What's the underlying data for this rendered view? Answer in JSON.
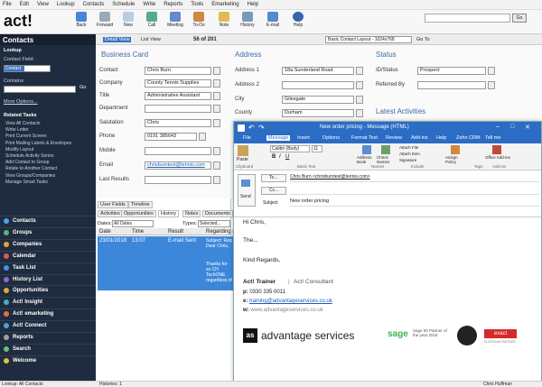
{
  "menu": [
    "File",
    "Edit",
    "View",
    "Lookup",
    "Contacts",
    "Schedule",
    "Write",
    "Reports",
    "Tools",
    "Emarketing",
    "Help"
  ],
  "logo": "act!",
  "toolbar": {
    "back": "Back",
    "forward": "Forward",
    "new": "New",
    "call": "Call",
    "meeting": "Meeting",
    "todo": "To-Do",
    "note": "Note",
    "history": "History",
    "email": "E-mail",
    "help": "Help",
    "search_go": "Go"
  },
  "nav": {
    "title": "Contacts",
    "lookup": "Lookup",
    "contact_field": "Contact Field:",
    "field_value": "Contact",
    "contains": "Contains:",
    "go": "Go",
    "more_options": "More Options...",
    "related_tasks": "Related Tasks",
    "tasks": [
      "View All Contacts",
      "Write Letter",
      "Print Current Screen",
      "Print Mailing Labels & Envelopes",
      "Modify Layout",
      "Schedule Activity Series",
      "Add Contact to Group",
      "Relate to Another Contact",
      "View Groups/Companies",
      "Manage Smart Tasks"
    ],
    "buttons": [
      {
        "label": "Contacts",
        "color": "#4aa3e8"
      },
      {
        "label": "Groups",
        "color": "#5bb56a"
      },
      {
        "label": "Companies",
        "color": "#e0a33a"
      },
      {
        "label": "Calendar",
        "color": "#e05a4a"
      },
      {
        "label": "Task List",
        "color": "#4a8ee0"
      },
      {
        "label": "History List",
        "color": "#8a6ad0"
      },
      {
        "label": "Opportunities",
        "color": "#d0b040"
      },
      {
        "label": "Act! Insight",
        "color": "#40b0c0"
      },
      {
        "label": "Act! emarketing",
        "color": "#e07040"
      },
      {
        "label": "Act! Connect",
        "color": "#50a0e0"
      },
      {
        "label": "Reports",
        "color": "#a0a0a0"
      },
      {
        "label": "Search",
        "color": "#70c070"
      },
      {
        "label": "Welcome",
        "color": "#e0c040"
      }
    ]
  },
  "subbar": {
    "detail": "Detail View",
    "list": "List View",
    "record": "56 of 201",
    "layout": "Basic Contact Layout - 1024x768",
    "goto": "Go To"
  },
  "business": {
    "title": "Business Card",
    "fields": [
      {
        "label": "Contact",
        "value": "Chris Burn"
      },
      {
        "label": "Company",
        "value": "County Tennis Supplies"
      },
      {
        "label": "Title",
        "value": "Administrative Assistant"
      },
      {
        "label": "Department",
        "value": ""
      },
      {
        "label": "Salutation",
        "value": "Chris"
      },
      {
        "label": "Phone",
        "value": "0191 385643"
      },
      {
        "label": "Mobile",
        "value": ""
      },
      {
        "label": "Email",
        "value": "chrisburntest@tennis.com"
      },
      {
        "label": "Last Results",
        "value": ""
      }
    ]
  },
  "address": {
    "title": "Address",
    "fields": [
      {
        "label": "Address 1",
        "value": "18a Sunderland Road"
      },
      {
        "label": "Address 2",
        "value": ""
      },
      {
        "label": "City",
        "value": "Gilesgate"
      },
      {
        "label": "County",
        "value": "Durham"
      }
    ]
  },
  "statusSec": {
    "title": "Status",
    "fields": [
      {
        "label": "ID/Status",
        "value": "Prospect"
      },
      {
        "label": "Referred By",
        "value": ""
      }
    ],
    "latest": "Latest Activities"
  },
  "tabs": {
    "row1": [
      "User Fields",
      "Timeline"
    ],
    "row2": [
      "Activities",
      "Opportunities",
      "History",
      "Notes",
      "Documents"
    ],
    "dates_label": "Dates:",
    "dates_value": "All Dates",
    "types_label": "Types:",
    "types_value": "Selected...",
    "columns": [
      "Date",
      "Time",
      "Result",
      "Regarding &"
    ],
    "row": {
      "date": "23/01/2018",
      "time": "13:07",
      "result": "E-mail Sent",
      "regarding": "Subject: Req Dear Chris,",
      "extra": "Thanks for so CH TechONE regardless of"
    }
  },
  "outlook": {
    "title": "New order pricing - Message (HTML)",
    "tabs": [
      "File",
      "Message",
      "Insert",
      "Options",
      "Format Text",
      "Review",
      "Add-ins",
      "Help",
      "Zoho CRM",
      "Tell me"
    ],
    "font": "Calibri (Body)",
    "size": "11",
    "ribbon": {
      "paste": "Paste",
      "clipboard": "Clipboard",
      "basic": "Basic Text",
      "address_book": "Address Book",
      "check_names": "Check Names",
      "names": "Names",
      "attach_file": "Attach File",
      "attach_item": "Attach Item",
      "signature": "Signature",
      "include": "Include",
      "assign": "Assign Policy",
      "tags": "Tags",
      "office_addins": "Office Add-ins",
      "addins": "Add-ins"
    },
    "send": "Send",
    "to_btn": "To...",
    "cc_btn": "Cc...",
    "subject_label": "Subject",
    "to_value": "Chris Burn <chrisburntest@tennis.com>",
    "subject_value": "New order pricing",
    "body": {
      "greeting": "Hi Chris,",
      "line": "The...",
      "closing": "Kind Regards,",
      "name": "Act! Trainer",
      "role": "Act! Consultant",
      "p": "0330 335 0011",
      "e": "training@advantageservices.co.uk",
      "w": "www.advantageservices.co.uk",
      "brand": "advantage services",
      "sage": "sage",
      "sage_text": "Sage 50 Partner of the year 2016",
      "exact": "exact",
      "exact_sub": "PLATINUM PARTNER"
    }
  },
  "statusbar": {
    "left": "Lookup: All Contacts",
    "mid": "Histories: 1",
    "right": "Chris Huffman"
  }
}
